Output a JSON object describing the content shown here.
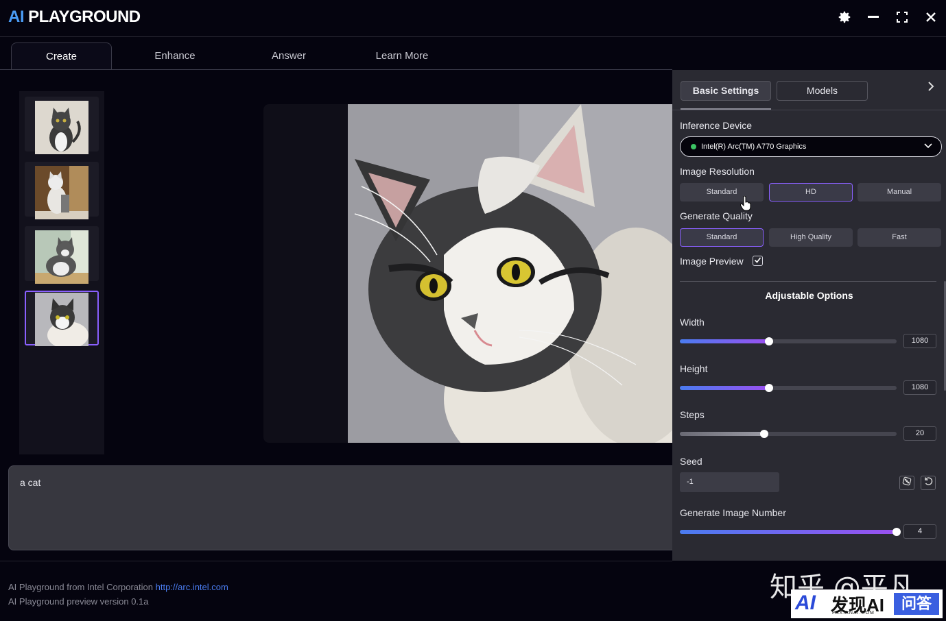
{
  "app": {
    "title_ai": "AI",
    "title_rest": " PLAYGROUND"
  },
  "tabs": [
    {
      "label": "Create"
    },
    {
      "label": "Enhance"
    },
    {
      "label": "Answer"
    },
    {
      "label": "Learn More"
    }
  ],
  "prompt": {
    "value": "a cat"
  },
  "footer": {
    "line1": "AI Playground from Intel Corporation ",
    "link": "http://arc.intel.com",
    "line2": "AI Playground preview version 0.1a"
  },
  "panel": {
    "tabs": {
      "basic": "Basic Settings",
      "models": "Models"
    },
    "inference_device": {
      "label": "Inference Device",
      "value": "Intel(R) Arc(TM) A770 Graphics"
    },
    "image_resolution": {
      "label": "Image Resolution",
      "options": [
        "Standard",
        "HD",
        "Manual"
      ],
      "selected": "HD"
    },
    "generate_quality": {
      "label": "Generate Quality",
      "options": [
        "Standard",
        "High Quality",
        "Fast"
      ],
      "selected": "Standard"
    },
    "image_preview": {
      "label": "Image Preview",
      "checked": true
    },
    "adjustable_title": "Adjustable Options",
    "width": {
      "label": "Width",
      "value": "1080",
      "fraction": 0.41
    },
    "height": {
      "label": "Height",
      "value": "1080",
      "fraction": 0.41
    },
    "steps": {
      "label": "Steps",
      "value": "20",
      "fraction": 0.39
    },
    "seed": {
      "label": "Seed",
      "value": "-1"
    },
    "image_number": {
      "label": "Generate Image Number",
      "value": "4",
      "fraction": 1.0
    }
  },
  "watermark": {
    "zhihu": "知乎 @平凡",
    "badge_ai": "AI",
    "badge_main": "发现AI",
    "badge_sub": "FAXIANAI.COM",
    "badge_qa": "问答"
  },
  "colors": {
    "accent": "#8a60ff",
    "brand_blue": "#4a9cf5",
    "link": "#4a7cf0"
  }
}
